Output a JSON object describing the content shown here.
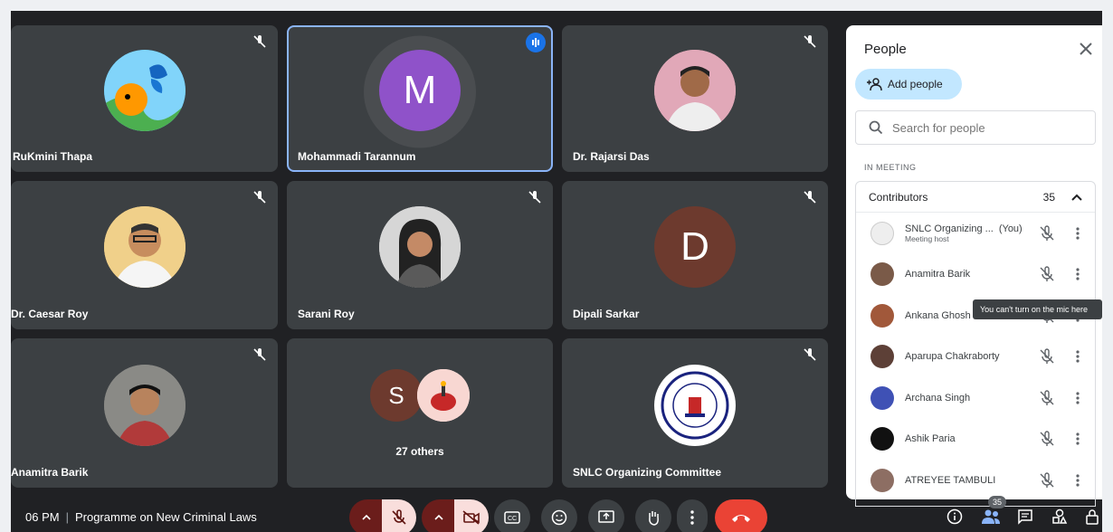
{
  "participants": [
    {
      "name": "RuKmini Thapa",
      "muted": true
    },
    {
      "name": "Mohammadi Tarannum",
      "muted": false,
      "speaking": true,
      "initial": "M",
      "color": "#8f52c9"
    },
    {
      "name": "Dr. Rajarsi Das",
      "muted": true
    },
    {
      "name": "Dr. Caesar Roy",
      "muted": true
    },
    {
      "name": "Sarani Roy",
      "muted": true
    },
    {
      "name": "Dipali Sarkar",
      "muted": true,
      "initial": "D",
      "color": "#6d3a2e"
    },
    {
      "name": "Anamitra Barik",
      "muted": true
    },
    {
      "name": "",
      "others_label": "27 others",
      "initial": "S",
      "color": "#6d3a2e"
    },
    {
      "name": "SNLC Organizing Committee",
      "muted": true
    }
  ],
  "people_panel": {
    "title": "People",
    "add_people_label": "Add people",
    "search_placeholder": "Search for people",
    "section_label": "IN MEETING",
    "group_label": "Contributors",
    "group_count": "35",
    "rows": [
      {
        "name": "SNLC Organizing ...",
        "you": "(You)",
        "sub": "Meeting host"
      },
      {
        "name": "Anamitra Barik",
        "you": "",
        "sub": ""
      },
      {
        "name": "Ankana Ghosh",
        "you": "",
        "sub": ""
      },
      {
        "name": "Aparupa Chakraborty",
        "you": "",
        "sub": ""
      },
      {
        "name": "Archana Singh",
        "you": "",
        "sub": ""
      },
      {
        "name": "Ashik Paria",
        "you": "",
        "sub": ""
      },
      {
        "name": "ATREYEE TAMBULI",
        "you": "",
        "sub": ""
      }
    ],
    "tooltip": "You can't turn on the mic here"
  },
  "bottom_bar": {
    "time": "06 PM",
    "meeting_title": "Programme on New Criminal Laws",
    "people_badge": "35"
  },
  "colors": {
    "background": "#202124",
    "tile": "#3c4043",
    "active_outline": "#8ab4f8",
    "accent_blue": "#1a73e8",
    "end_call_red": "#ea4335"
  }
}
